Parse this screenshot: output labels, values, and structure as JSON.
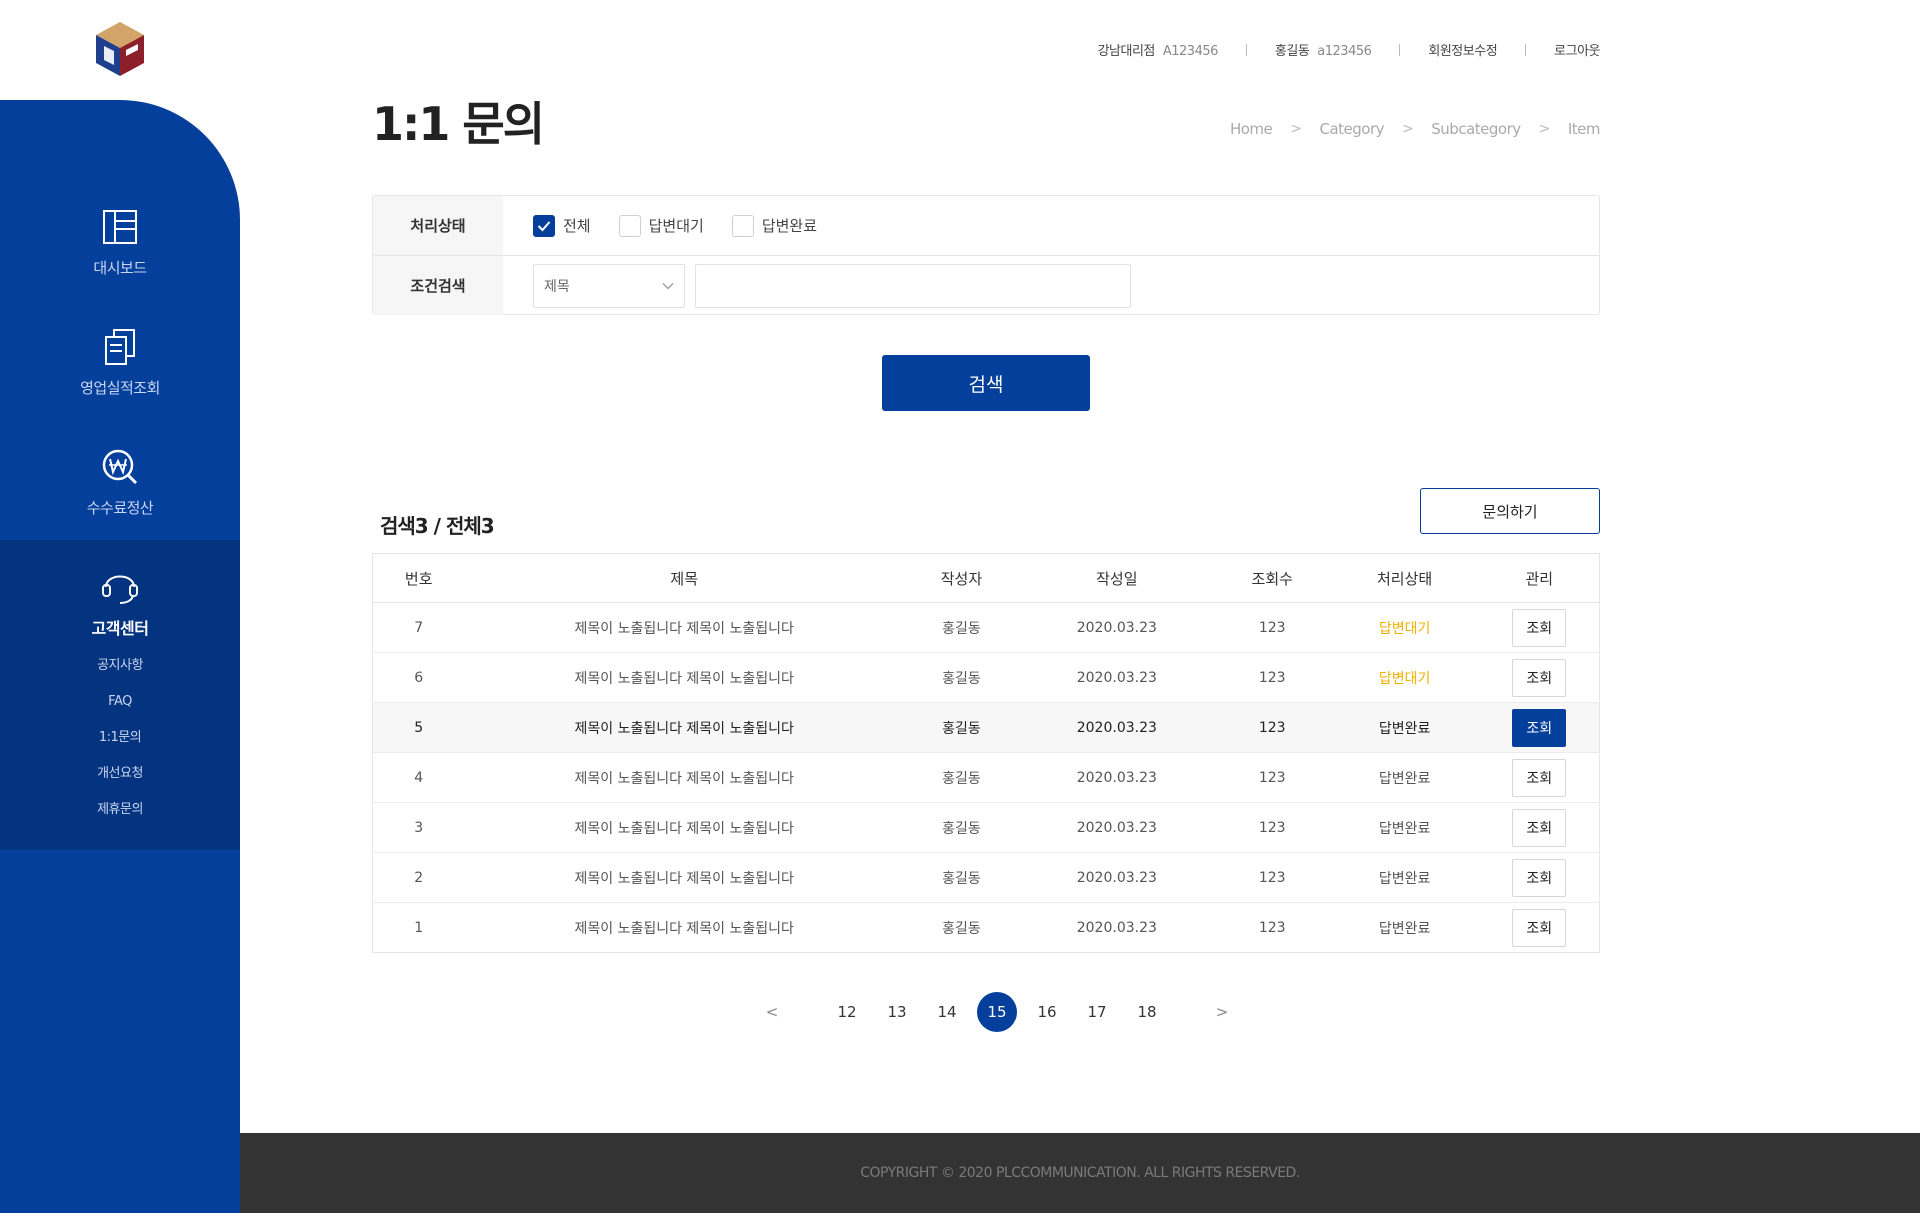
{
  "brand": {
    "accent": "#053f9c",
    "accent_dark": "#043380",
    "pending_color": "#f0b000",
    "footer_bg": "#333333"
  },
  "sidebar": {
    "items": [
      {
        "label": "대시보드",
        "icon": "dashboard-icon"
      },
      {
        "label": "영업실적조회",
        "icon": "documents-icon"
      },
      {
        "label": "수수료정산",
        "icon": "won-search-icon"
      },
      {
        "label": "고객센터",
        "icon": "headset-icon",
        "active": true
      }
    ],
    "subitems": [
      "공지사항",
      "FAQ",
      "1:1문의",
      "개선요청",
      "제휴문의"
    ]
  },
  "header": {
    "branch": "강남대리점",
    "branch_code": "A123456",
    "user": "홍길동",
    "user_id": "a123456",
    "edit_profile": "회원정보수정",
    "logout": "로그아웃"
  },
  "page": {
    "title": "1:1 문의",
    "breadcrumb": [
      "Home",
      "Category",
      "Subcategory",
      "Item"
    ]
  },
  "filter": {
    "status_label": "처리상태",
    "status_options": [
      {
        "label": "전체",
        "checked": true
      },
      {
        "label": "답변대기",
        "checked": false
      },
      {
        "label": "답변완료",
        "checked": false
      }
    ],
    "condition_label": "조건검색",
    "condition_select": "제목",
    "search_value": "",
    "search_button": "검색"
  },
  "results": {
    "count_text": "검색3 / 전체3",
    "inquire_button": "문의하기",
    "columns": [
      "번호",
      "제목",
      "작성자",
      "작성일",
      "조회수",
      "처리상태",
      "관리"
    ],
    "rows": [
      {
        "no": "7",
        "title": "제목이 노출됩니다 제목이 노출됩니다",
        "author": "홍길동",
        "date": "2020.03.23",
        "views": "123",
        "status": "답변대기",
        "action": "조회"
      },
      {
        "no": "6",
        "title": "제목이 노출됩니다 제목이 노출됩니다",
        "author": "홍길동",
        "date": "2020.03.23",
        "views": "123",
        "status": "답변대기",
        "action": "조회"
      },
      {
        "no": "5",
        "title": "제목이 노출됩니다 제목이 노출됩니다",
        "author": "홍길동",
        "date": "2020.03.23",
        "views": "123",
        "status": "답변완료",
        "action": "조회"
      },
      {
        "no": "4",
        "title": "제목이 노출됩니다 제목이 노출됩니다",
        "author": "홍길동",
        "date": "2020.03.23",
        "views": "123",
        "status": "답변완료",
        "action": "조회"
      },
      {
        "no": "3",
        "title": "제목이 노출됩니다 제목이 노출됩니다",
        "author": "홍길동",
        "date": "2020.03.23",
        "views": "123",
        "status": "답변완료",
        "action": "조회"
      },
      {
        "no": "2",
        "title": "제목이 노출됩니다 제목이 노출됩니다",
        "author": "홍길동",
        "date": "2020.03.23",
        "views": "123",
        "status": "답변완료",
        "action": "조회"
      },
      {
        "no": "1",
        "title": "제목이 노출됩니다 제목이 노출됩니다",
        "author": "홍길동",
        "date": "2020.03.23",
        "views": "123",
        "status": "답변완료",
        "action": "조회"
      }
    ]
  },
  "pagination": {
    "pages": [
      "12",
      "13",
      "14",
      "15",
      "16",
      "17",
      "18"
    ],
    "current": "15"
  },
  "footer": {
    "copyright": "COPYRIGHT © 2020 PLCCOMMUNICATION. ALL RIGHTS RESERVED."
  }
}
